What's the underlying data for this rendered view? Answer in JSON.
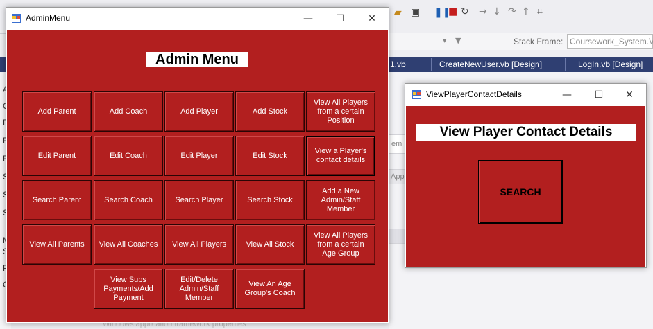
{
  "ide": {
    "stack_frame_label": "Stack Frame:",
    "stack_frame_value": "Coursework_System.Vie",
    "tabs": [
      "1.vb",
      "CreateNewUser.vb [Design]",
      "LogIn.vb [Design]"
    ],
    "left_letters": [
      "A",
      "C",
      "D",
      "R",
      "R",
      "S",
      "S",
      "S",
      "M",
      "S",
      "P",
      "C"
    ],
    "ghost_em": "em",
    "ghost_app": "App",
    "bottom_text": "Windows application framework properties"
  },
  "admin_menu": {
    "window_title": "AdminMenu",
    "heading": "Admin Menu",
    "buttons": [
      [
        "Add Parent",
        "Add Coach",
        "Add Player",
        "Add Stock",
        "View All Players from a certain Position"
      ],
      [
        "Edit Parent",
        "Edit Coach",
        "Edit Player",
        "Edit Stock",
        "View a Player's contact details"
      ],
      [
        "Search Parent",
        "Search Coach",
        "Search Player",
        "Search Stock",
        "Add a New Admin/Staff Member"
      ],
      [
        "View All Parents",
        "View All Coaches",
        "View All Players",
        "View All Stock",
        "View All Players from a certain Age Group"
      ],
      [
        "View Subs Payments/Add Payment",
        "Edit/Delete Admin/Staff Member",
        "View An Age Group's Coach"
      ]
    ]
  },
  "contact_window": {
    "window_title": "ViewPlayerContactDetails",
    "heading": "View Player Contact Details",
    "search_label": "SEARCH"
  },
  "window_controls": {
    "minimize": "—",
    "maximize": "☐",
    "close": "✕"
  },
  "colors": {
    "form_background": "#b21f1f",
    "ide_tab_bar": "#2f3f72"
  }
}
